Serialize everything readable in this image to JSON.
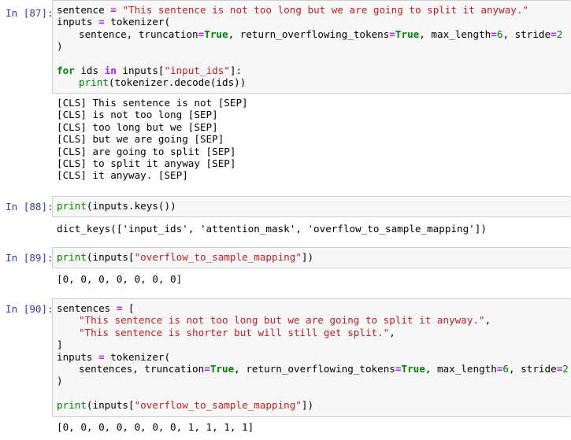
{
  "cells": [
    {
      "prompt": "In [87]:",
      "code": [
        [
          [
            "t",
            "sentence "
          ],
          [
            "op",
            "="
          ],
          [
            "t",
            " "
          ],
          [
            "str",
            "\"This sentence is not too long but we are going to split it anyway.\""
          ]
        ],
        [
          [
            "t",
            "inputs "
          ],
          [
            "op",
            "="
          ],
          [
            "t",
            " tokenizer("
          ]
        ],
        [
          [
            "ind",
            ""
          ],
          [
            "t",
            "sentence, truncation"
          ],
          [
            "op",
            "="
          ],
          [
            "kw",
            "True"
          ],
          [
            "t",
            ", return_overflowing_tokens"
          ],
          [
            "op",
            "="
          ],
          [
            "kw",
            "True"
          ],
          [
            "t",
            ", max_length"
          ],
          [
            "op",
            "="
          ],
          [
            "num",
            "6"
          ],
          [
            "t",
            ", stride"
          ],
          [
            "op",
            "="
          ],
          [
            "num",
            "2"
          ]
        ],
        [
          [
            "t",
            ")"
          ]
        ],
        [
          [
            "t",
            ""
          ]
        ],
        [
          [
            "kw",
            "for"
          ],
          [
            "t",
            " ids "
          ],
          [
            "op",
            "in"
          ],
          [
            "t",
            " inputs["
          ],
          [
            "str",
            "\"input_ids\""
          ],
          [
            "t",
            "]:"
          ]
        ],
        [
          [
            "ind",
            ""
          ],
          [
            "bi",
            "print"
          ],
          [
            "t",
            "(tokenizer.decode(ids))"
          ]
        ]
      ],
      "output": [
        "[CLS] This sentence is not [SEP]",
        "[CLS] is not too long [SEP]",
        "[CLS] too long but we [SEP]",
        "[CLS] but we are going [SEP]",
        "[CLS] are going to split [SEP]",
        "[CLS] to split it anyway [SEP]",
        "[CLS] it anyway. [SEP]"
      ]
    },
    {
      "prompt": "In [88]:",
      "code": [
        [
          [
            "bi",
            "print"
          ],
          [
            "t",
            "(inputs.keys())"
          ]
        ]
      ],
      "output": [
        "dict_keys(['input_ids', 'attention_mask', 'overflow_to_sample_mapping'])"
      ]
    },
    {
      "prompt": "In [89]:",
      "code": [
        [
          [
            "bi",
            "print"
          ],
          [
            "t",
            "(inputs["
          ],
          [
            "str",
            "\"overflow_to_sample_mapping\""
          ],
          [
            "t",
            "])"
          ]
        ]
      ],
      "output": [
        "[0, 0, 0, 0, 0, 0, 0]"
      ]
    },
    {
      "prompt": "In [90]:",
      "code": [
        [
          [
            "t",
            "sentences "
          ],
          [
            "op",
            "="
          ],
          [
            "t",
            " ["
          ]
        ],
        [
          [
            "ind",
            ""
          ],
          [
            "str",
            "\"This sentence is not too long but we are going to split it anyway.\""
          ],
          [
            "t",
            ","
          ]
        ],
        [
          [
            "ind",
            ""
          ],
          [
            "str",
            "\"This sentence is shorter but will still get split.\""
          ],
          [
            "t",
            ","
          ]
        ],
        [
          [
            "t",
            "]"
          ]
        ],
        [
          [
            "t",
            "inputs "
          ],
          [
            "op",
            "="
          ],
          [
            "t",
            " tokenizer("
          ]
        ],
        [
          [
            "ind",
            ""
          ],
          [
            "t",
            "sentences, truncation"
          ],
          [
            "op",
            "="
          ],
          [
            "kw",
            "True"
          ],
          [
            "t",
            ", return_overflowing_tokens"
          ],
          [
            "op",
            "="
          ],
          [
            "kw",
            "True"
          ],
          [
            "t",
            ", max_length"
          ],
          [
            "op",
            "="
          ],
          [
            "num",
            "6"
          ],
          [
            "t",
            ", stride"
          ],
          [
            "op",
            "="
          ],
          [
            "num",
            "2"
          ]
        ],
        [
          [
            "t",
            ")"
          ]
        ],
        [
          [
            "t",
            ""
          ]
        ],
        [
          [
            "bi",
            "print"
          ],
          [
            "t",
            "(inputs["
          ],
          [
            "str",
            "\"overflow_to_sample_mapping\""
          ],
          [
            "t",
            "])"
          ]
        ]
      ],
      "output": [
        "[0, 0, 0, 0, 0, 0, 0, 1, 1, 1, 1]"
      ]
    }
  ]
}
